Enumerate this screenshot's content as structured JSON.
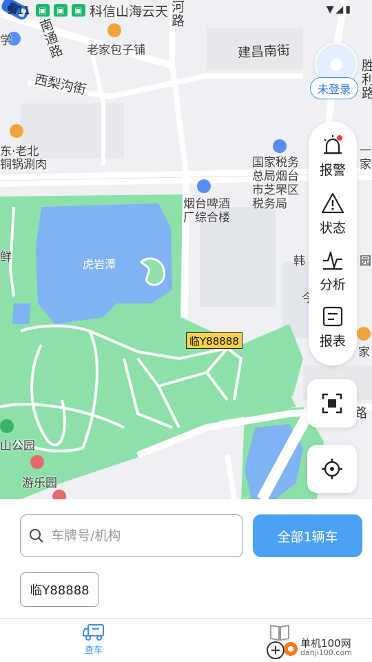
{
  "status_bar": {
    "time": "5:11"
  },
  "map": {
    "labels": {
      "kexin": "科信山海云天",
      "he_lu": "河路",
      "nantong_lu": "南通路",
      "laojia_baozipu": "老家包子铺",
      "jianchang_nanjie": "建昌南街",
      "xili_goujie": "西梨沟街",
      "sheng_li_lu": "胜利路",
      "dong_laobei": "东·老北",
      "tongguo_shuanrou": "铜锅涮肉",
      "tax_bureau": "国家税务总局烟台市芝罘区税务局",
      "yi": "一",
      "jia": "家",
      "brewery": "烟台啤酒厂综合楼",
      "xian": "鲜",
      "huyantan": "虎岩潭",
      "han": "韩",
      "yuan": "园",
      "jin": "今",
      "jia2": "家",
      "lu": "路",
      "shan_gongyuan": "山公园",
      "youleyuan": "游乐园",
      "xue": "学"
    },
    "vehicle_plate": "临Y88888"
  },
  "user": {
    "login_label": "未登录"
  },
  "side_panel": {
    "alarm": "报警",
    "status": "状态",
    "analysis": "分析",
    "report": "报表"
  },
  "search": {
    "placeholder": "车牌号/机构",
    "value": ""
  },
  "all_vehicles_button": "全部1辆车",
  "plate_chip": "临Y88888",
  "tabs": {
    "vehicle": "查车"
  },
  "watermark": {
    "name": "单机100网",
    "domain": "danji100.com"
  },
  "colors": {
    "accent": "#4aa1f6",
    "park": "#8ee0a9",
    "water": "#7fb3f2",
    "plate": "#f6d24a"
  }
}
